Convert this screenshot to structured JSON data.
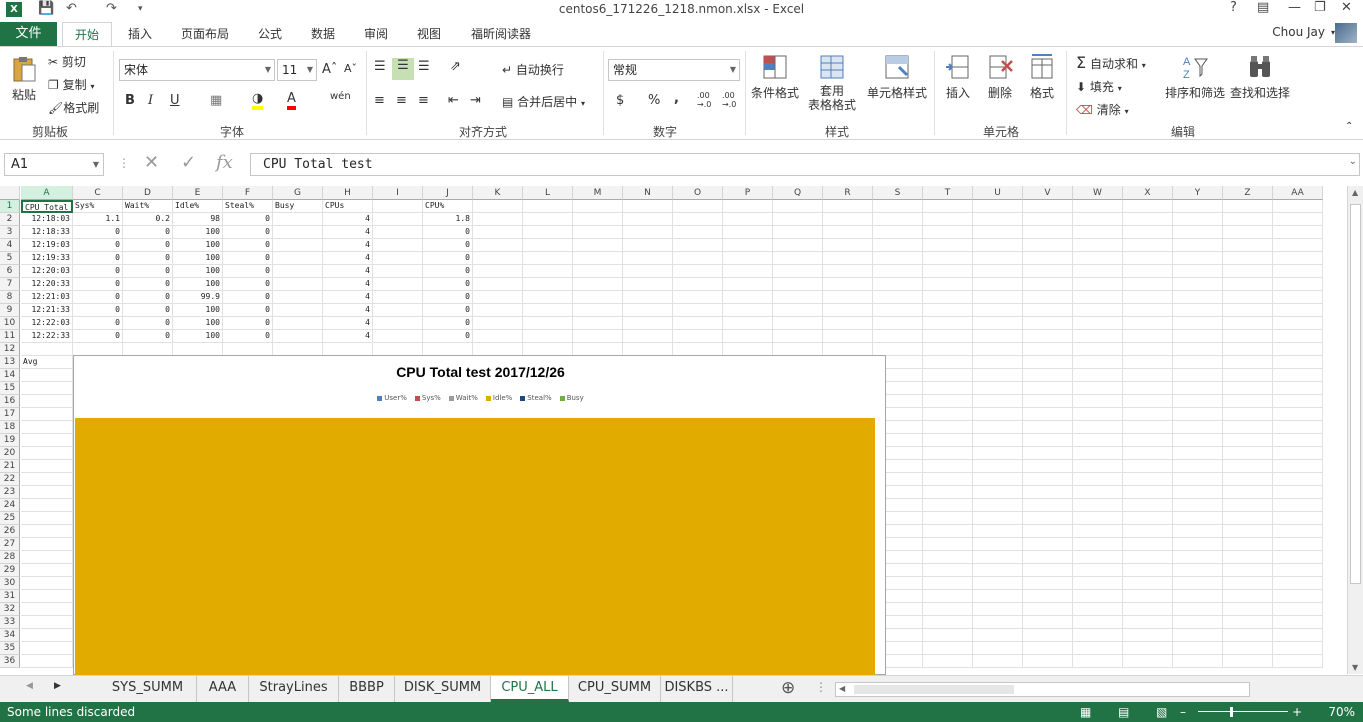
{
  "window": {
    "title": "centos6_171226_1218.nmon.xlsx - Excel",
    "help": "?",
    "user": "Chou Jay"
  },
  "ribbon_tabs": [
    "文件",
    "开始",
    "插入",
    "页面布局",
    "公式",
    "数据",
    "审阅",
    "视图",
    "福昕阅读器"
  ],
  "clipboard": {
    "paste": "粘贴",
    "cut": "剪切",
    "copy": "复制",
    "format_painter": "格式刷",
    "label": "剪贴板"
  },
  "font": {
    "name": "宋体",
    "size": "11",
    "label": "字体",
    "bold": "B",
    "italic": "I",
    "underline": "U"
  },
  "alignment": {
    "wrap": "自动换行",
    "merge": "合并后居中",
    "label": "对齐方式"
  },
  "number": {
    "format": "常规",
    "label": "数字",
    "currency": "$",
    "percent": "%",
    "comma": ",",
    "inc": ".00 →.0",
    "dec": ".00 →.0"
  },
  "styles": {
    "conditional": "条件格式",
    "table_l1": "套用",
    "table_l2": "表格格式",
    "cell_styles": "单元格样式",
    "label": "样式"
  },
  "cells": {
    "insert": "插入",
    "delete": "删除",
    "format": "格式",
    "label": "单元格"
  },
  "editing": {
    "autosum": "自动求和",
    "fill": "填充",
    "clear": "清除",
    "sort": "排序和筛选",
    "find": "查找和选择",
    "label": "编辑"
  },
  "formula_bar": {
    "name_box": "A1",
    "fx": "fx",
    "content": "CPU Total test"
  },
  "columns": [
    "A",
    "C",
    "D",
    "E",
    "F",
    "G",
    "H",
    "I",
    "J",
    "K",
    "L",
    "M",
    "N",
    "O",
    "P",
    "Q",
    "R",
    "S",
    "T",
    "U",
    "V",
    "W",
    "X",
    "Y",
    "Z",
    "AA"
  ],
  "rows": [
    "1",
    "2",
    "3",
    "4",
    "5",
    "6",
    "7",
    "8",
    "9",
    "10",
    "11",
    "12",
    "13",
    "14",
    "15",
    "16",
    "17",
    "18",
    "19",
    "20",
    "21",
    "22",
    "23",
    "24",
    "25",
    "26",
    "27",
    "28",
    "29",
    "30",
    "31",
    "32",
    "33",
    "34",
    "35",
    "36"
  ],
  "sheet": {
    "header": [
      "CPU Total",
      "Sys%",
      "Wait%",
      "Idle%",
      "Steal%",
      "Busy",
      "CPUs",
      "",
      "CPU%"
    ],
    "data": [
      [
        "12:18:03",
        "1.1",
        "0.2",
        "98",
        "0",
        "",
        "4",
        "",
        "1.8"
      ],
      [
        "12:18:33",
        "0",
        "0",
        "100",
        "0",
        "",
        "4",
        "",
        "0"
      ],
      [
        "12:19:03",
        "0",
        "0",
        "100",
        "0",
        "",
        "4",
        "",
        "0"
      ],
      [
        "12:19:33",
        "0",
        "0",
        "100",
        "0",
        "",
        "4",
        "",
        "0"
      ],
      [
        "12:20:03",
        "0",
        "0",
        "100",
        "0",
        "",
        "4",
        "",
        "0"
      ],
      [
        "12:20:33",
        "0",
        "0",
        "100",
        "0",
        "",
        "4",
        "",
        "0"
      ],
      [
        "12:21:03",
        "0",
        "0",
        "99.9",
        "0",
        "",
        "4",
        "",
        "0"
      ],
      [
        "12:21:33",
        "0",
        "0",
        "100",
        "0",
        "",
        "4",
        "",
        "0"
      ],
      [
        "12:22:03",
        "0",
        "0",
        "100",
        "0",
        "",
        "4",
        "",
        "0"
      ],
      [
        "12:22:33",
        "0",
        "0",
        "100",
        "0",
        "",
        "4",
        "",
        "0"
      ]
    ],
    "avg_label": "Avg"
  },
  "chart_data": {
    "type": "area",
    "title": "CPU Total test  2017/12/26",
    "series": [
      {
        "name": "User%",
        "color": "#4f81bd"
      },
      {
        "name": "Sys%",
        "color": "#c0504d"
      },
      {
        "name": "Wait%",
        "color": "#9b9b9b"
      },
      {
        "name": "Idle%",
        "color": "#e2ab00"
      },
      {
        "name": "Steal%",
        "color": "#1f497d"
      },
      {
        "name": "Busy",
        "color": "#70ad47"
      }
    ],
    "fill_color": "#e2ab00"
  },
  "sheet_tabs": [
    "SYS_SUMM",
    "AAA",
    "StrayLines",
    "BBBP",
    "DISK_SUMM",
    "CPU_ALL",
    "CPU_SUMM",
    "DISKBS ..."
  ],
  "active_sheet": "CPU_ALL",
  "status": {
    "message": "Some lines discarded",
    "zoom": "70%"
  }
}
